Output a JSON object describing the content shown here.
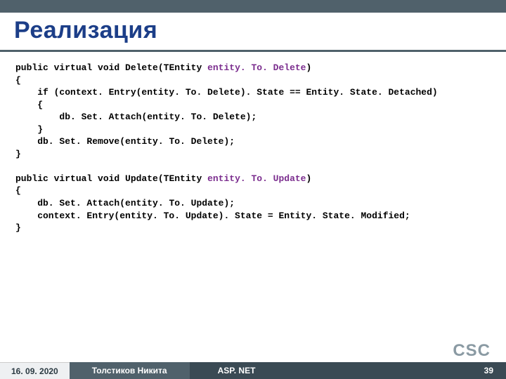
{
  "slide": {
    "title": "Реализация"
  },
  "code": {
    "l1a": "public virtual void ",
    "l1b": "Delete",
    "l1c": "(TEntity ",
    "l1d": "entity. To. Delete",
    "l1e": ")",
    "l2": "{",
    "l3a": "    if ",
    "l3b": "(context. Entry(entity. To. Delete). State == Entity. State. ",
    "l3c": "Detached",
    "l3d": ")",
    "l4": "    {",
    "l5a": "        db. Set. ",
    "l5b": "Attach",
    "l5c": "(entity. To. Delete);",
    "l6": "    }",
    "l7a": "    db. Set. ",
    "l7b": "Remove",
    "l7c": "(entity. To. Delete);",
    "l8": "}",
    "u1a": "public virtual void ",
    "u1b": "Update",
    "u1c": "(TEntity ",
    "u1d": "entity. To. Update",
    "u1e": ")",
    "u2": "{",
    "u3a": "    db. Set. ",
    "u3b": "Attach",
    "u3c": "(entity. To. Update);",
    "u4a": "    context. Entry(entity. To. Update). State = Entity. State. ",
    "u4b": "Modified",
    "u4c": ";",
    "u5": "}"
  },
  "footer": {
    "date": "16. 09. 2020",
    "author": "Толстиков Никита",
    "course": "ASP. NET",
    "page": "39",
    "logo": "CSC"
  }
}
